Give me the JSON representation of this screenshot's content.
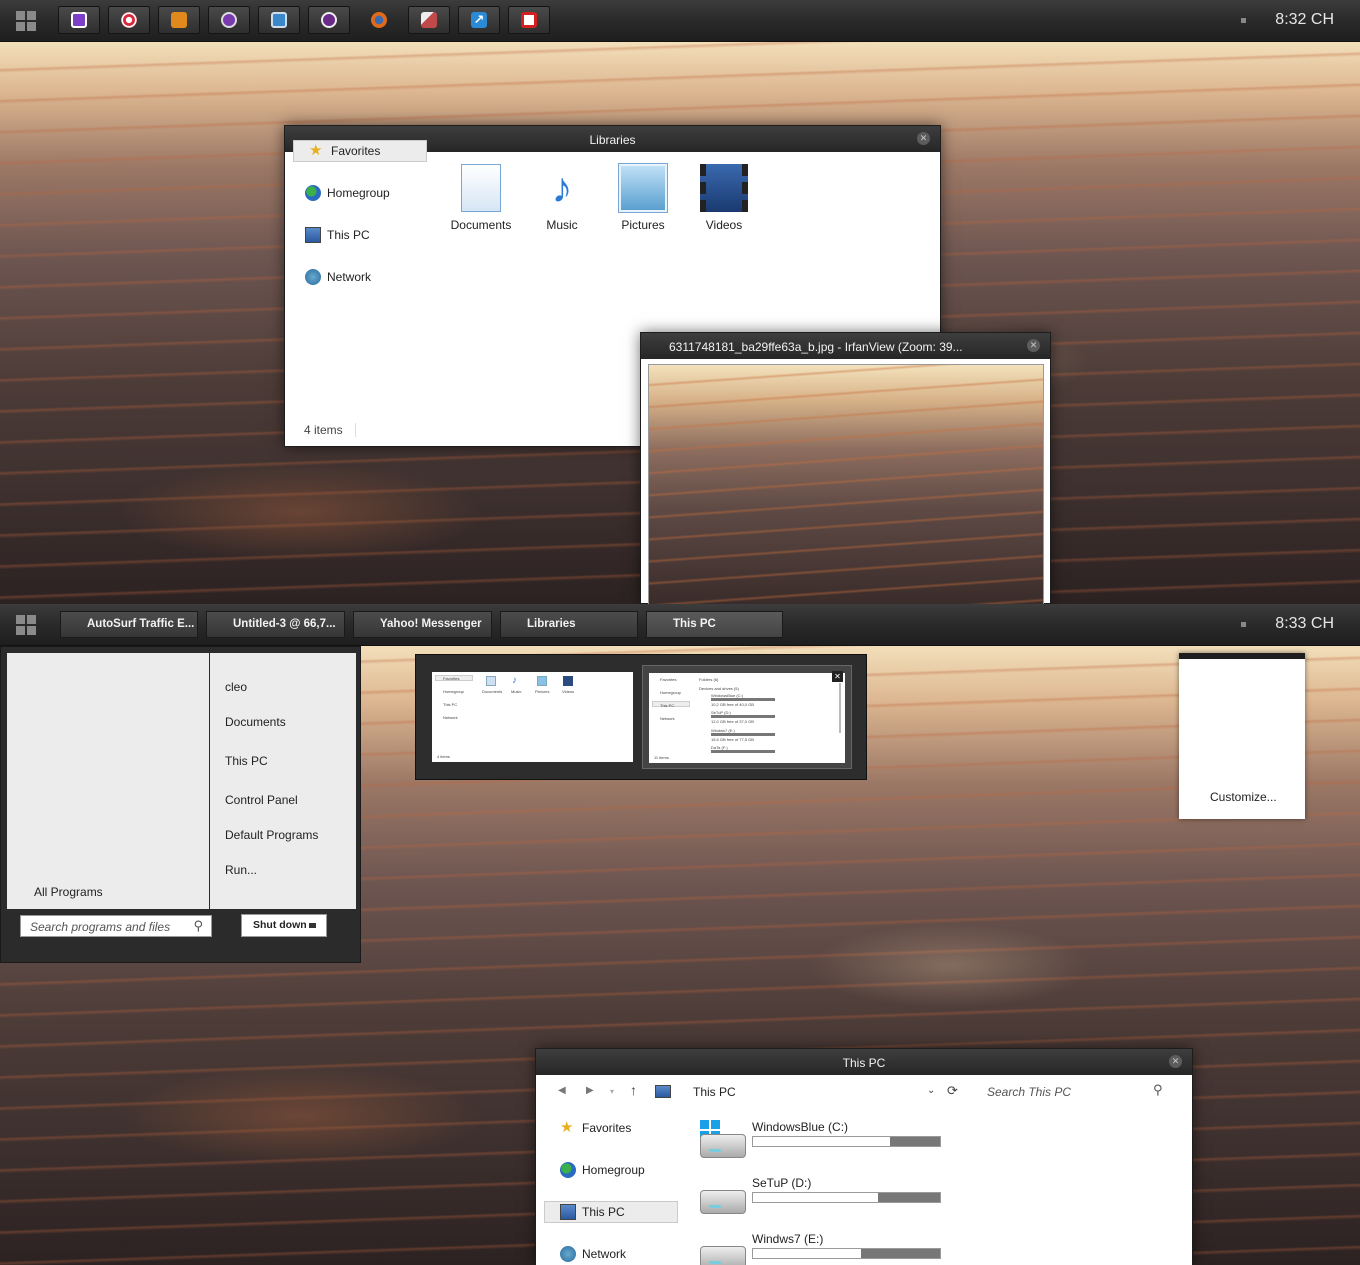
{
  "top_taskbar": {
    "clock": "8:32 CH",
    "quick_icons": [
      {
        "name": "window-app-icon",
        "color": "#7d3fc7"
      },
      {
        "name": "target-app-icon",
        "color": "#d9263a"
      },
      {
        "name": "flame-app-icon",
        "color": "#e08a1e"
      },
      {
        "name": "chat-app-icon",
        "color": "#7a3ab0"
      },
      {
        "name": "image-app-icon",
        "color": "#3a88c9"
      },
      {
        "name": "media-app-icon",
        "color": "#6a2a8a"
      },
      {
        "name": "firefox-icon",
        "color": "#e06a1a"
      },
      {
        "name": "chart-app-icon",
        "color": "#c04a4a"
      },
      {
        "name": "shortcut-arrow-icon",
        "color": "#2a8ad6"
      },
      {
        "name": "puzzle-app-icon",
        "color": "#d42020"
      }
    ]
  },
  "libraries_window": {
    "title": "Libraries",
    "nav": [
      "Favorites",
      "Homegroup",
      "This PC",
      "Network"
    ],
    "items": [
      "Documents",
      "Music",
      "Pictures",
      "Videos"
    ],
    "status": "4 items"
  },
  "irfanview_window": {
    "title": "6311748181_ba29ffe63a_b.jpg - IrfanView (Zoom: 39..."
  },
  "bottom_taskbar": {
    "clock": "8:33 CH",
    "tasks": [
      "AutoSurf Traffic E...",
      "Untitled-3 @ 66,7...",
      "Yahoo! Messenger",
      "Libraries",
      "This PC"
    ]
  },
  "start_menu": {
    "items": [
      "cleo",
      "Documents",
      "This PC",
      "Control Panel",
      "Default Programs",
      "Run..."
    ],
    "all_programs": "All Programs",
    "search_placeholder": "Search programs and files",
    "shutdown": "Shut down"
  },
  "thumbnails": {
    "libraries": {
      "nav": [
        "Favorites",
        "Homegroup",
        "This PC",
        "Network"
      ],
      "items": [
        "Documents",
        "Music",
        "Pictures",
        "Videos"
      ],
      "status": "4 items"
    },
    "this_pc": {
      "nav": [
        "Favorites",
        "Homegroup",
        "This PC",
        "Network"
      ],
      "folders": "Folders (6)",
      "devices": "Devices and drives (5)",
      "drives": [
        "WindowsBlue (C:)",
        "SeTuP (D:)",
        "Windws7 (E:)",
        "DaTa (F:)"
      ],
      "drive_details": [
        "10,2 GB free of 40,0 GB",
        "12,0 GB free of 37,0 GB",
        "15,5 GB free of 77,5 GB"
      ],
      "status": "11 items"
    }
  },
  "jump_list": {
    "customize": "Customize..."
  },
  "thispc_window": {
    "title": "This PC",
    "address": "This PC",
    "search_placeholder": "Search This PC",
    "nav": [
      "Favorites",
      "Homegroup",
      "This PC",
      "Network"
    ],
    "drives": [
      {
        "name": "WindowsBlue (C:)",
        "free_fraction": 0.73
      },
      {
        "name": "SeTuP (D:)",
        "free_fraction": 0.67
      },
      {
        "name": "Windws7 (E:)",
        "free_fraction": 0.58
      }
    ]
  }
}
